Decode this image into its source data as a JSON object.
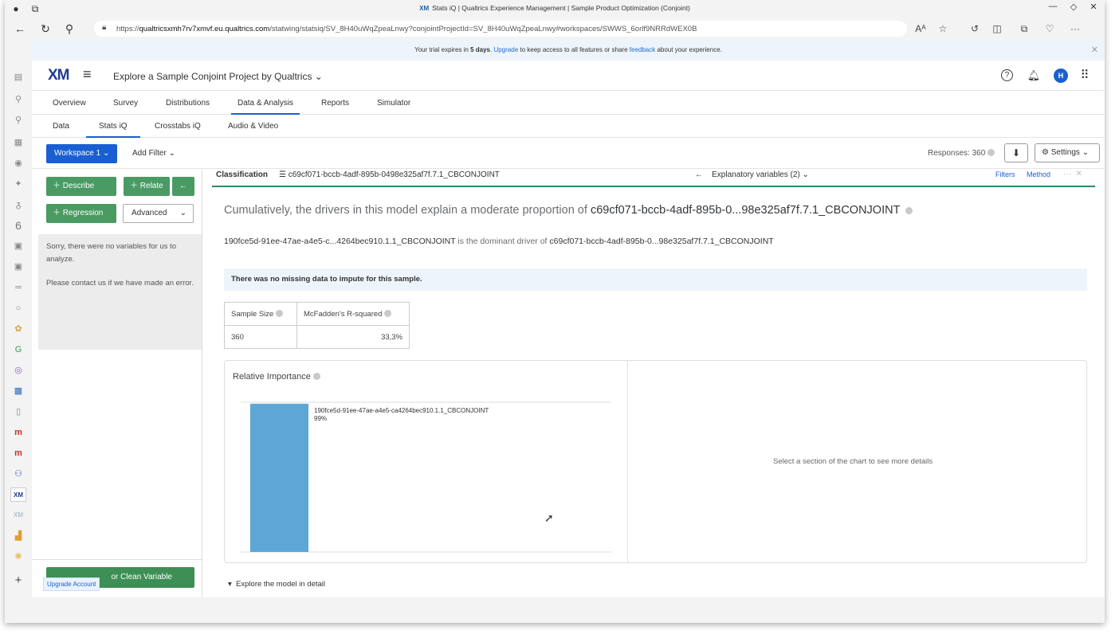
{
  "browser": {
    "window_title": "Stats iQ | Qualtrics Experience Management | Sample Product Optimization (Conjoint)",
    "title_badge": "XM",
    "url_host": "qualtricsxmh7rv7xmvf.eu.qualtrics.com",
    "url_prefix": "https://",
    "url_path": "/statwing/statsiq/SV_8H40uWqZpeaLnwy?conjointProjectId=SV_8H40uWqZpeaLnwy#workspaces/SWWS_6orlf9NRRdWEX0B",
    "read_aloud": "Aᴬ"
  },
  "trial": {
    "prefix": "Your trial expires in ",
    "days": "5 days",
    "mid": ". ",
    "upgrade": "Upgrade",
    "mid2": " to keep access to all features or share ",
    "feedback": "feedback",
    "suffix": " about your experience."
  },
  "header": {
    "logo": "XM",
    "project": "Explore a Sample Conjoint Project by Qualtrics",
    "avatar": "H"
  },
  "nav_tabs": [
    "Overview",
    "Survey",
    "Distributions",
    "Data & Analysis",
    "Reports",
    "Simulator"
  ],
  "sub_tabs": [
    "Data",
    "Stats iQ",
    "Crosstabs iQ",
    "Audio & Video"
  ],
  "toolbar": {
    "workspace": "Workspace 1",
    "add_filter": "Add Filter",
    "responses": "Responses: 360",
    "settings": "Settings"
  },
  "left": {
    "describe": "Describe",
    "relate": "Relate",
    "regression": "Regression",
    "advanced": "Advanced",
    "msg1": "Sorry, there were no variables for us to analyze.",
    "msg2": "Please contact us if we have made an error.",
    "clean": "or Clean Variable",
    "upgrade": "Upgrade Account"
  },
  "main": {
    "classification": "Classification",
    "target_var": "c69cf071-bccb-4adf-895b-0498e325af7f.7.1_CBCONJOINT",
    "explanatory": "Explanatory variables (2)",
    "filters": "Filters",
    "method": "Method",
    "headline_prefix": "Cumulatively, the drivers in this model explain a moderate proportion of ",
    "headline_var": "c69cf071-bccb-4adf-895b-0...98e325af7f.7.1_CBCONJOINT",
    "dominant_var": "190fce5d-91ee-47ae-a4e5-c...4264bec910.1.1_CBCONJOINT",
    "dominant_mid": " is the dominant driver of ",
    "dominant_target": "c69cf071-bccb-4adf-895b-0...98e325af7f.7.1_CBCONJOINT",
    "missing": "There was no missing data to impute for this sample.",
    "sample_size_label": "Sample Size",
    "rsq_label": "McFadden's R-squared",
    "sample_size": "360",
    "rsq": "33,3%",
    "ri_title": "Relative Importance",
    "ri_hint": "Select a section of the chart to see more details",
    "explore": "Explore the model in detail"
  },
  "colors": {
    "accent": "#1a5fd1",
    "green": "#4a9a63",
    "bar": "#5ea6d6"
  },
  "chart_data": {
    "type": "bar",
    "categories": [
      "190fce5d-91ee-47ae-a4e5-ca4264bec910.1.1_CBCONJOINT"
    ],
    "values": [
      99
    ],
    "value_labels": [
      "99%"
    ],
    "ylim": [
      0,
      100
    ],
    "title": "Relative Importance"
  }
}
